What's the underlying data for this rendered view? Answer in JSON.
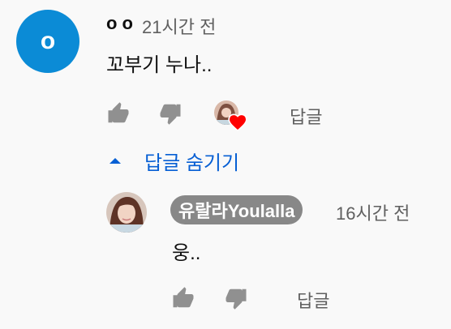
{
  "comment": {
    "avatar_letter": "o",
    "author": "o o",
    "time": "21시간 전",
    "text": "꼬부기 누나..",
    "reply_label": "답글",
    "hide_replies_label": "답글 숨기기"
  },
  "reply": {
    "author": "유랄라Youlalla",
    "time": "16시간 전",
    "text": "웅..",
    "reply_label": "답글"
  },
  "colors": {
    "avatar_bg": "#0b8bd6",
    "link_blue": "#065fd4",
    "heart_red": "#ff0000",
    "chip_gray": "#888888",
    "icon_gray": "#909090"
  },
  "icons": {
    "like": "thumb-up-icon",
    "dislike": "thumb-down-icon",
    "heart": "heart-icon",
    "collapse": "caret-up-icon"
  }
}
